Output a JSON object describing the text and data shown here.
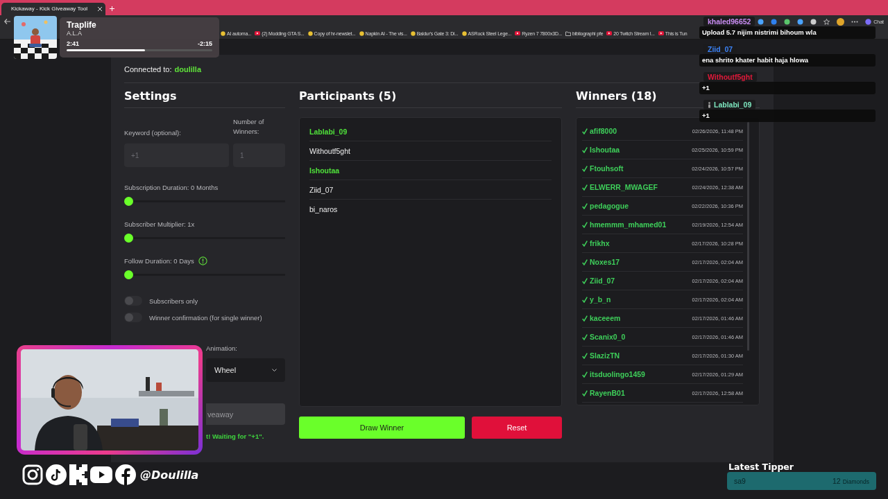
{
  "browser": {
    "tab_title": "Kickaway - Kick Giveaway Tool",
    "chat_button": "Chat",
    "bookmarks": [
      {
        "label": "AI automa...",
        "kind": "site"
      },
      {
        "label": "(2) Modding GTA S...",
        "kind": "video"
      },
      {
        "label": "Copy of hr-newslet...",
        "kind": "site"
      },
      {
        "label": "Napkin AI - The vis...",
        "kind": "site"
      },
      {
        "label": "Baldur's Gate 3: Di...",
        "kind": "site"
      },
      {
        "label": "ASRock Steel Lege...",
        "kind": "site"
      },
      {
        "label": "Ryzen 7 7800x3D...",
        "kind": "video"
      },
      {
        "label": "bibliographi pfe",
        "kind": "folder"
      },
      {
        "label": "20 Twitch Stream I...",
        "kind": "video"
      },
      {
        "label": "This is Tun",
        "kind": "video"
      }
    ]
  },
  "now_playing": {
    "title": "Traplife",
    "artist": "A.L.A",
    "elapsed": "2:41",
    "remaining": "-2:15",
    "level": 0.54
  },
  "app": {
    "connected_label": "Connected to:",
    "channel": "doulilla",
    "settings": {
      "title": "Settings",
      "keyword": {
        "label": "Keyword (optional):",
        "placeholder": "+1"
      },
      "winner_count": {
        "label": "Number of Winners:",
        "placeholder": "1"
      },
      "sliders": [
        {
          "label": "Subscription Duration: 0 Months",
          "level": 0,
          "info": false
        },
        {
          "label": "Subscriber Multiplier: 1x",
          "level": 0,
          "info": false
        },
        {
          "label": "Follow Duration: 0 Days",
          "level": 0,
          "info": true
        }
      ],
      "toggles": [
        {
          "label": "Subscribers only",
          "on": false
        },
        {
          "label": "Winner confirmation (for single winner)",
          "on": false
        }
      ],
      "animation": {
        "label": "Animation:",
        "value": "Wheel"
      },
      "start_button": "veaway",
      "status": "t! Waiting for \"+1\"."
    },
    "participants": {
      "title": "Participants (5)",
      "items": [
        {
          "name": "Lablabi_09",
          "highlighted": true
        },
        {
          "name": "Withoutf5ght",
          "highlighted": false
        },
        {
          "name": "Ishoutaa",
          "highlighted": true
        },
        {
          "name": "Ziid_07",
          "highlighted": false
        },
        {
          "name": "bi_naros",
          "highlighted": false
        }
      ]
    },
    "winners": {
      "title": "Winners (18)",
      "items": [
        {
          "name": "afif8000",
          "time": "02/26/2026, 11:48 PM"
        },
        {
          "name": "Ishoutaa",
          "time": "02/25/2026, 10:59 PM"
        },
        {
          "name": "Ftouhsoft",
          "time": "02/24/2026, 10:57 PM"
        },
        {
          "name": "ELWERR_MWAGEF",
          "time": "02/24/2026, 12:38 AM"
        },
        {
          "name": "pedagogue",
          "time": "02/22/2026, 10:36 PM"
        },
        {
          "name": "hmemmm_mhamed01",
          "time": "02/19/2026, 12:54 AM"
        },
        {
          "name": "frikhx",
          "time": "02/17/2026, 10:28 PM"
        },
        {
          "name": "Noxes17",
          "time": "02/17/2026, 02:04 AM"
        },
        {
          "name": "Ziid_07",
          "time": "02/17/2026, 02:04 AM"
        },
        {
          "name": "y_b_n",
          "time": "02/17/2026, 02:04 AM"
        },
        {
          "name": "kaceeem",
          "time": "02/17/2026, 01:46 AM"
        },
        {
          "name": "Scanix0_0",
          "time": "02/17/2026, 01:46 AM"
        },
        {
          "name": "SlazizTN",
          "time": "02/17/2026, 01:30 AM"
        },
        {
          "name": "itsduolingo1459",
          "time": "02/17/2026, 01:29 AM"
        },
        {
          "name": "RayenB01",
          "time": "02/17/2026, 12:58 AM"
        }
      ]
    },
    "draw_button": "Draw Winner",
    "reset_button": "Reset"
  },
  "chat": [
    {
      "user": "khaled96652",
      "color": "#c78bf0",
      "badge": false,
      "message": "Upload 5.7 nijim nistrimi bihoum wla"
    },
    {
      "user": "Ziid_07",
      "color": "#3b82f6",
      "badge": false,
      "message": "ena shrito khater habit haja hlowa"
    },
    {
      "user": "Withoutf5ght",
      "color": "#e0193a",
      "badge": false,
      "message": "+1"
    },
    {
      "user": "Lablabi_09",
      "color": "#7ee8c0",
      "badge": true,
      "message": "+1"
    }
  ],
  "socials": {
    "handle": "@Doulilla"
  },
  "latest_tipper": {
    "title": "Latest Tipper",
    "name": "sa9",
    "amount": "12",
    "unit": "Diamonds"
  }
}
